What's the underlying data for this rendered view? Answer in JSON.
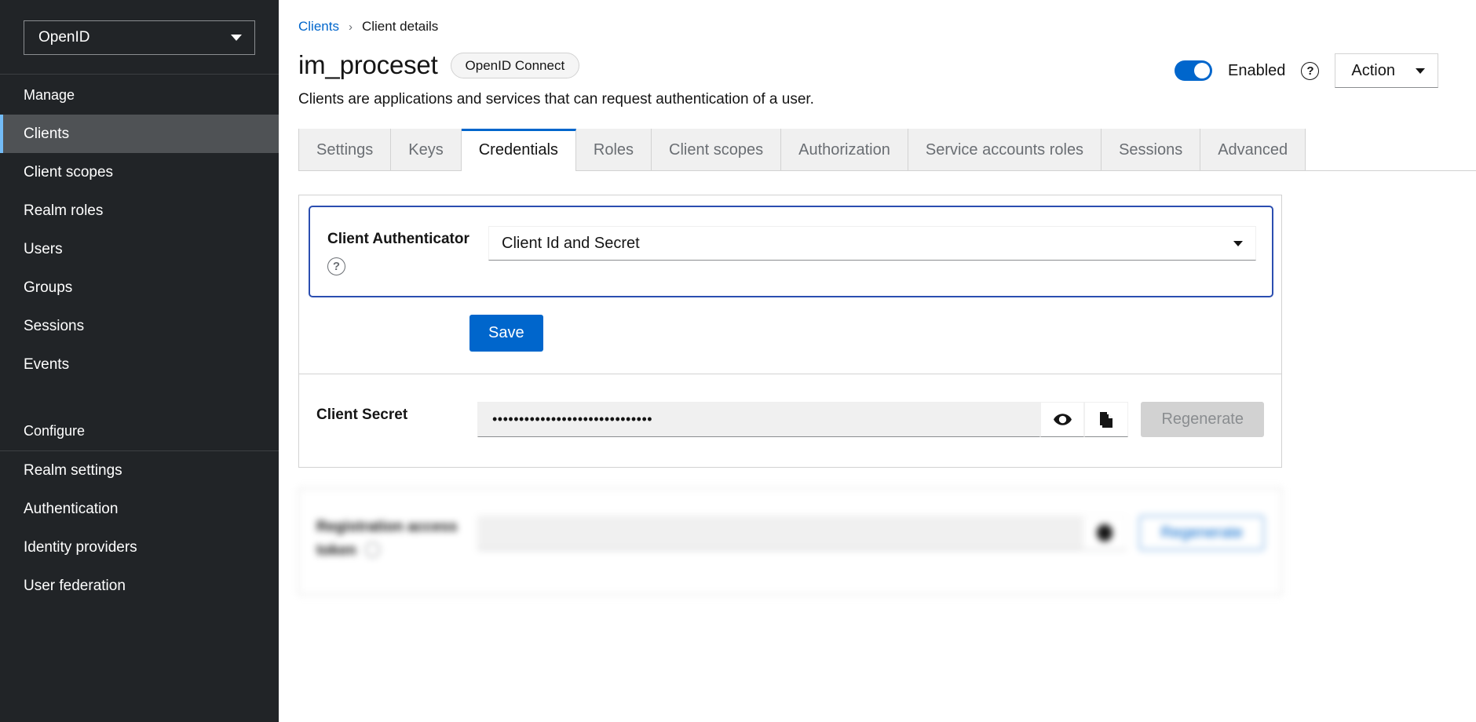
{
  "sidebar": {
    "realm_selector": {
      "value": "OpenID",
      "icon": "chevron-down-icon"
    },
    "sections": [
      {
        "label": "Manage",
        "items": [
          {
            "label": "Clients",
            "active": true
          },
          {
            "label": "Client scopes",
            "active": false
          },
          {
            "label": "Realm roles",
            "active": false
          },
          {
            "label": "Users",
            "active": false
          },
          {
            "label": "Groups",
            "active": false
          },
          {
            "label": "Sessions",
            "active": false
          },
          {
            "label": "Events",
            "active": false
          }
        ]
      },
      {
        "label": "Configure",
        "items": [
          {
            "label": "Realm settings",
            "active": false
          },
          {
            "label": "Authentication",
            "active": false
          },
          {
            "label": "Identity providers",
            "active": false
          },
          {
            "label": "User federation",
            "active": false
          }
        ]
      }
    ]
  },
  "breadcrumb": {
    "parent": "Clients",
    "separator": "›",
    "current": "Client details"
  },
  "header": {
    "title": "im_proceset",
    "badge": "OpenID Connect",
    "subtitle": "Clients are applications and services that can request authentication of a user.",
    "toggle_label": "Enabled",
    "toggle_on": true,
    "help_icon": "question-circle-icon",
    "action_label": "Action",
    "action_caret_icon": "caret-down-icon"
  },
  "tabs": [
    {
      "label": "Settings",
      "active": false
    },
    {
      "label": "Keys",
      "active": false
    },
    {
      "label": "Credentials",
      "active": true
    },
    {
      "label": "Roles",
      "active": false
    },
    {
      "label": "Client scopes",
      "active": false
    },
    {
      "label": "Authorization",
      "active": false
    },
    {
      "label": "Service accounts roles",
      "active": false
    },
    {
      "label": "Sessions",
      "active": false
    },
    {
      "label": "Advanced",
      "active": false
    }
  ],
  "credentials": {
    "authenticator": {
      "label": "Client Authenticator",
      "help_icon": "question-circle-icon",
      "value": "Client Id and Secret",
      "caret_icon": "caret-down-icon",
      "focused": true
    },
    "save_label": "Save",
    "secret": {
      "label": "Client Secret",
      "value": "••••••••••••••••••••••••••••••",
      "show_icon": "eye-icon",
      "copy_icon": "copy-icon",
      "regenerate_label": "Regenerate",
      "regenerate_disabled": true
    }
  },
  "registration": {
    "label": "Registration access token",
    "help_icon": "question-circle-icon",
    "value": "",
    "copy_icon": "copy-icon",
    "regenerate_label": "Regenerate"
  },
  "colors": {
    "accent_blue": "#0066cc",
    "sidebar_bg": "#212427",
    "active_nav": "#4f5255",
    "active_nav_bar": "#73bcf7",
    "focus_ring": "#2b4eb0",
    "disabled_btn": "#d2d2d2"
  }
}
